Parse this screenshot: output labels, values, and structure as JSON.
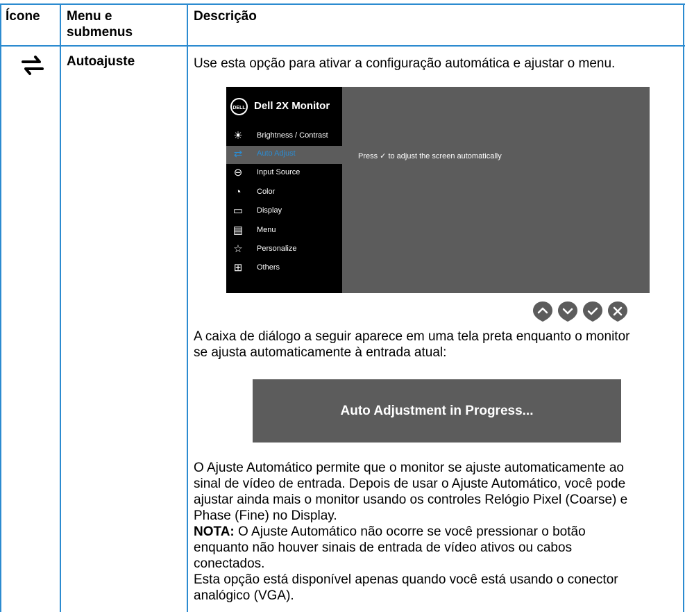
{
  "header": {
    "col_icon": "Ícone",
    "col_menu_line1": "Menu e",
    "col_menu_line2": "submenus",
    "col_desc": "Descrição"
  },
  "row": {
    "icon": "auto-adjust-arrows-icon",
    "menu_label": "Autoajuste",
    "intro": "Use esta opção para ativar a configuração automática e ajustar o menu.",
    "para_dialog_1": "A caixa de diálogo a seguir aparece em uma tela preta enquanto o monitor",
    "para_dialog_2": "se ajusta automaticamente à entrada atual:",
    "progress_text": "Auto Adjustment in Progress...",
    "p1_l1": "O Ajuste Automático permite que o monitor se ajuste automaticamente ao",
    "p1_l2": "sinal de vídeo de entrada. Depois de usar o Ajuste Automático, você pode",
    "p1_l3": "ajustar ainda mais o monitor usando os controles Relógio Pixel (Coarse) e",
    "p1_l4": "Phase (Fine) no Display.",
    "note_label": "NOTA:",
    "note_l1": " O Ajuste Automático não ocorre se você pressionar o botão",
    "note_l2": "enquanto não houver sinais de entrada de vídeo ativos ou cabos",
    "note_l3": "conectados.",
    "p3_l1": "Esta opção está disponível apenas quando você está usando o conector",
    "p3_l2": "analógico (VGA)."
  },
  "osd": {
    "logo": "DELL",
    "title": "Dell 2X Monitor",
    "message": "Press ✓ to adjust the screen automatically",
    "items": [
      {
        "label": "Brightness / Contrast",
        "icon": "brightness-icon",
        "glyph": "☀"
      },
      {
        "label": "Auto Adjust",
        "icon": "auto-adjust-icon",
        "glyph": "⇄"
      },
      {
        "label": "Input Source",
        "icon": "input-source-icon",
        "glyph": "⊖"
      },
      {
        "label": "Color",
        "icon": "color-icon",
        "glyph": "◔"
      },
      {
        "label": "Display",
        "icon": "display-icon",
        "glyph": "▭"
      },
      {
        "label": "Menu",
        "icon": "menu-icon",
        "glyph": "▤"
      },
      {
        "label": "Personalize",
        "icon": "personalize-star-icon",
        "glyph": "☆"
      },
      {
        "label": "Others",
        "icon": "others-icon",
        "glyph": "⊞"
      }
    ],
    "selected_index": 1,
    "accent_color": "#2c8bd0"
  },
  "nav_buttons": [
    "up-button-icon",
    "down-button-icon",
    "check-button-icon",
    "close-button-icon"
  ]
}
